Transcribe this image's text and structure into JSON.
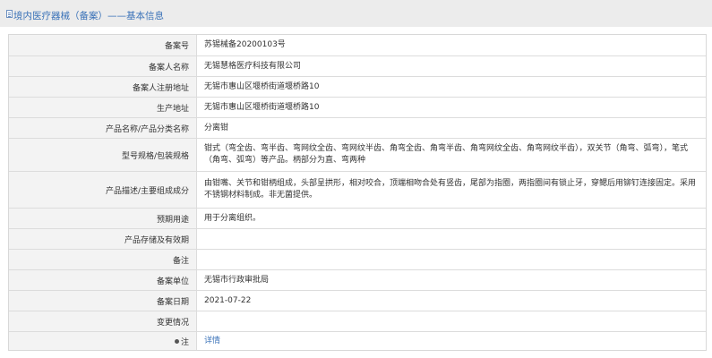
{
  "header": {
    "title": "境内医疗器械（备案）——基本信息"
  },
  "rows": [
    {
      "label": "备案号",
      "value": "苏锡械备20200103号"
    },
    {
      "label": "备案人名称",
      "value": "无锡慧格医疗科技有限公司"
    },
    {
      "label": "备案人注册地址",
      "value": "无锡市惠山区堰桥街道堰桥路10"
    },
    {
      "label": "生产地址",
      "value": "无锡市惠山区堰桥街道堰桥路10"
    },
    {
      "label": "产品名称/产品分类名称",
      "value": "分离钳"
    },
    {
      "label": "型号规格/包装规格",
      "value": "钳式（弯全齿、弯半齿、弯网纹全齿、弯网纹半齿、角弯全齿、角弯半齿、角弯网纹全齿、角弯网纹半齿），双关节（角弯、弧弯），笔式（角弯、弧弯）等产品。柄部分为直、弯两种"
    },
    {
      "label": "产品描述/主要组成成分",
      "value": "由钳嘴、关节和钳柄组成，头部呈拱形，相对咬合，顶端相吻合处有竖齿，尾部为指圈，两指圈间有锁止牙，穿鳃后用铆钉连接固定。采用不锈钢材料制成。非无菌提供。"
    },
    {
      "label": "预期用途",
      "value": "用于分离组织。"
    },
    {
      "label": "产品存储及有效期",
      "value": ""
    },
    {
      "label": "备注",
      "value": ""
    },
    {
      "label": "备案单位",
      "value": "无锡市行政审批局"
    },
    {
      "label": "备案日期",
      "value": "2021-07-22"
    },
    {
      "label": "变更情况",
      "value": ""
    },
    {
      "label": "注",
      "value": "详情"
    }
  ]
}
